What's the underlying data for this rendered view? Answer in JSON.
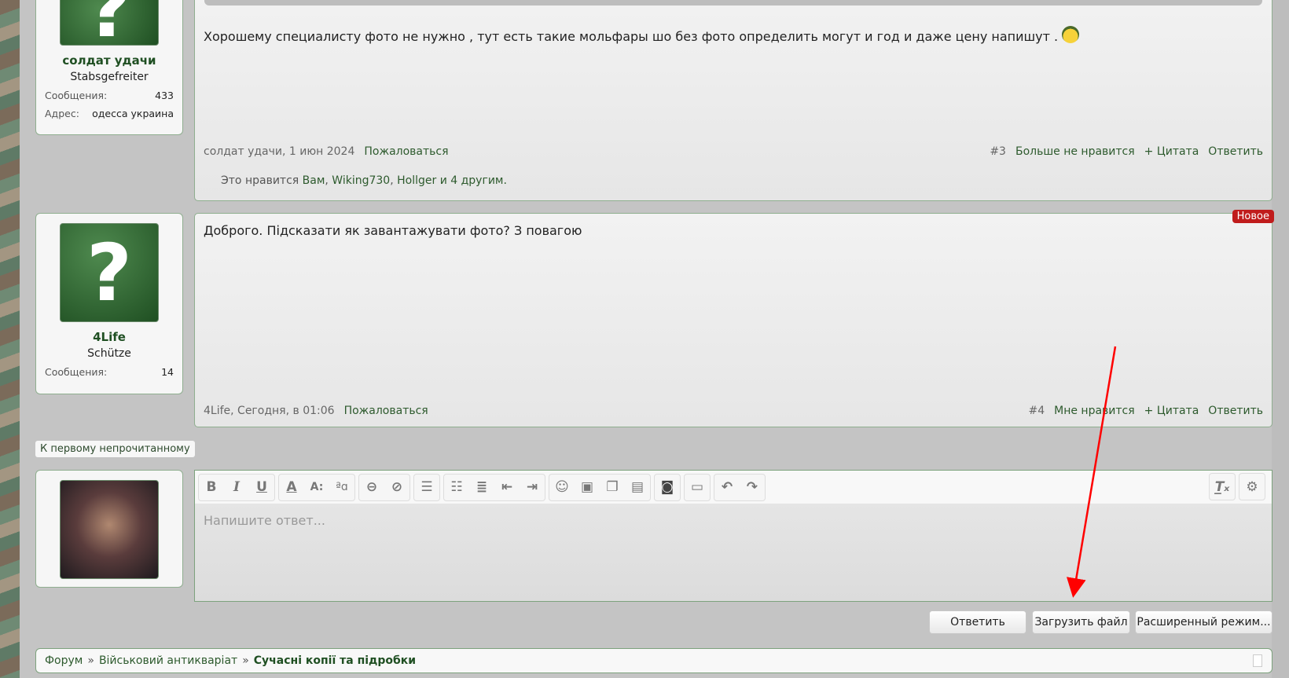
{
  "posts": [
    {
      "user": {
        "name": "солдат удачи",
        "title": "Stabsgefreiter",
        "stats": [
          {
            "k": "Сообщения:",
            "v": "433"
          },
          {
            "k": "Адрес:",
            "v": "одесса украина"
          }
        ]
      },
      "text": "Хорошему специалисту фото не нужно , тут есть такие мольфары шо без фото определить могут и год и даже цену напишут .",
      "author_date": "солдат удачи, 1 июн 2024",
      "report": "Пожаловаться",
      "num": "#3",
      "like": "Больше не нравится",
      "quote": "+ Цитата",
      "reply": "Ответить",
      "likes": {
        "prefix": "Это нравится ",
        "you": "Вам",
        "u1": "Wiking730",
        "u2": "Hollger",
        "rest": "и 4 другим."
      }
    },
    {
      "user": {
        "name": "4Life",
        "title": "Schütze",
        "stats": [
          {
            "k": "Сообщения:",
            "v": "14"
          }
        ]
      },
      "text": "Доброго. Підсказати як завантажувати фото? З повагою",
      "badge": "Новое",
      "author_date": "4Life, Сегодня, в 01:06",
      "report": "Пожаловаться",
      "num": "#4",
      "like": "Мне нравится",
      "quote": "+ Цитата",
      "reply": "Ответить"
    }
  ],
  "unread_link": "К первому непрочитанному",
  "editor": {
    "placeholder": "Напишите ответ..."
  },
  "buttons": {
    "reply": "Ответить",
    "upload": "Загрузить файл",
    "advanced": "Расширенный режим..."
  },
  "breadcrumb": [
    "Форум",
    "Військовий антикваріат",
    "Сучасні копії та підробки"
  ],
  "breadcrumb_sep": "»",
  "colors": {
    "accent": "#1f4f22",
    "badge": "#c01c1c",
    "arrow": "#ff0000"
  }
}
